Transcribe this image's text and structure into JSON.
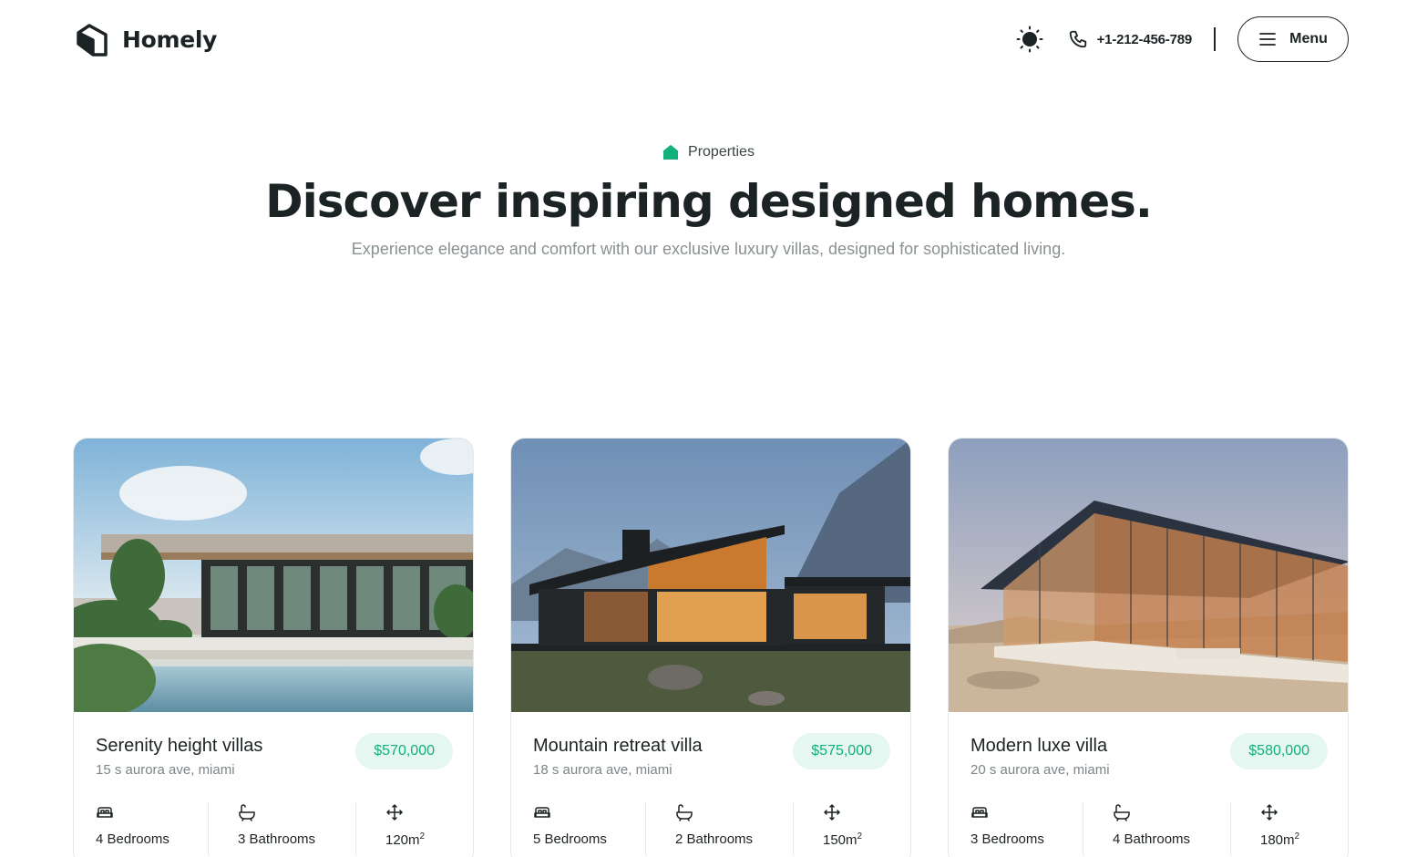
{
  "brand": {
    "name": "Homely"
  },
  "header": {
    "phone": "+1-212-456-789",
    "menu_label": "Menu"
  },
  "hero": {
    "eyebrow": "Properties",
    "title": "Discover inspiring designed homes.",
    "subtitle": "Experience elegance and comfort with our exclusive luxury villas, designed for sophisticated living."
  },
  "colors": {
    "accent": "#12b07d",
    "price_bg": "#e6f7f1",
    "text_dark": "#1c2324",
    "text_muted": "#8a9193"
  },
  "properties": [
    {
      "title": "Serenity height villas",
      "address": "15 s aurora ave, miami",
      "price": "$570,000",
      "bedrooms": "4 Bedrooms",
      "bathrooms": "3 Bathrooms",
      "area": "120m",
      "area_unit_exp": "2"
    },
    {
      "title": "Mountain retreat villa",
      "address": "18 s aurora ave, miami",
      "price": "$575,000",
      "bedrooms": "5 Bedrooms",
      "bathrooms": "2 Bathrooms",
      "area": "150m",
      "area_unit_exp": "2"
    },
    {
      "title": "Modern luxe villa",
      "address": "20 s aurora ave, miami",
      "price": "$580,000",
      "bedrooms": "3 Bedrooms",
      "bathrooms": "4 Bathrooms",
      "area": "180m",
      "area_unit_exp": "2"
    }
  ],
  "icons": {
    "logo": "house-logo-icon",
    "theme": "sun-icon",
    "phone": "phone-icon",
    "menu": "hamburger-icon",
    "eyebrow": "house-icon",
    "bed": "bed-icon",
    "bath": "bathtub-icon",
    "area": "move-arrows-icon"
  }
}
